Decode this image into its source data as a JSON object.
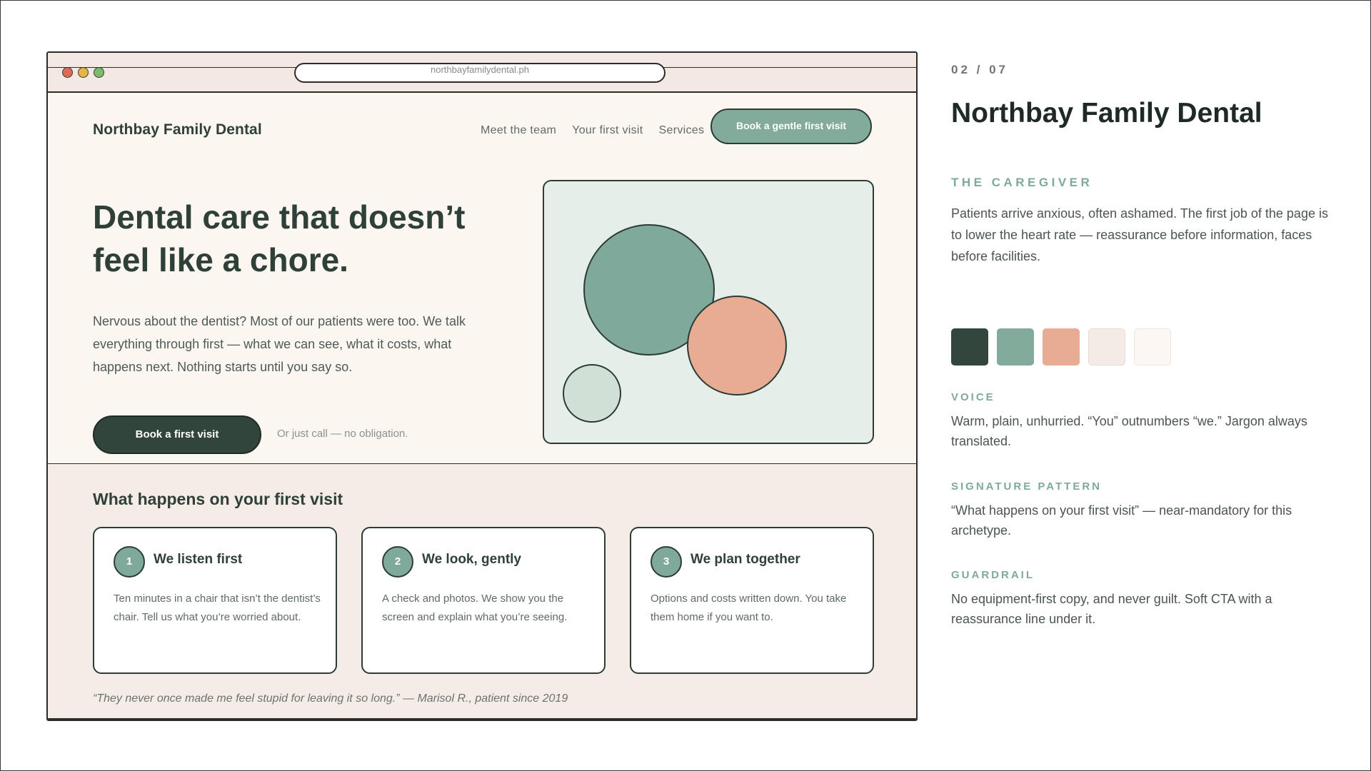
{
  "slide": {
    "counter": "02 / 07",
    "title": "Northbay Family Dental",
    "archetype_label": "THE CAREGIVER",
    "archetype_text": "Patients arrive anxious, often ashamed. The first job of the page is to lower the heart rate — reassurance before information, faces before facilities.",
    "palette": [
      "#33463e",
      "#82ab9c",
      "#e7ac91",
      "#f4ebe6",
      "#fcf7f2"
    ],
    "voice_label": "VOICE",
    "voice_text": "Warm, plain, unhurried. “You” outnumbers “we.” Jargon always translated.",
    "signature_label": "SIGNATURE PATTERN",
    "signature_text": "“What happens on your first visit” — near-mandatory for this archetype.",
    "guardrail_label": "GUARDRAIL",
    "guardrail_text": "No equipment-first copy, and never guilt. Soft CTA with a reassurance line under it."
  },
  "browser": {
    "url": "northbayfamilydental.ph"
  },
  "site": {
    "brand": "Northbay Family Dental",
    "nav": [
      "Meet the team",
      "Your first visit",
      "Services"
    ],
    "nav_cta": "Book a gentle first visit",
    "hero_title": "Dental care that doesn’t feel like a chore.",
    "hero_body": "Nervous about the dentist? Most of our patients were too. We talk everything through first — what we can see, what it costs, what happens next. Nothing starts until you say so.",
    "hero_button": "Book a first visit",
    "hero_note": "Or just call — no obligation.",
    "visit_title": "What happens on your first visit",
    "steps": [
      {
        "num": "1",
        "title": "We listen first",
        "body": "Ten minutes in a chair that isn’t the dentist’s chair. Tell us what you’re worried about."
      },
      {
        "num": "2",
        "title": "We look, gently",
        "body": "A check and photos. We show you the screen and explain what you’re seeing."
      },
      {
        "num": "3",
        "title": "We plan together",
        "body": "Options and costs written down. You take them home if you want to."
      }
    ],
    "testimonial": "“They never once made me feel stupid for leaving it so long.”  — Marisol R., patient since 2019"
  }
}
